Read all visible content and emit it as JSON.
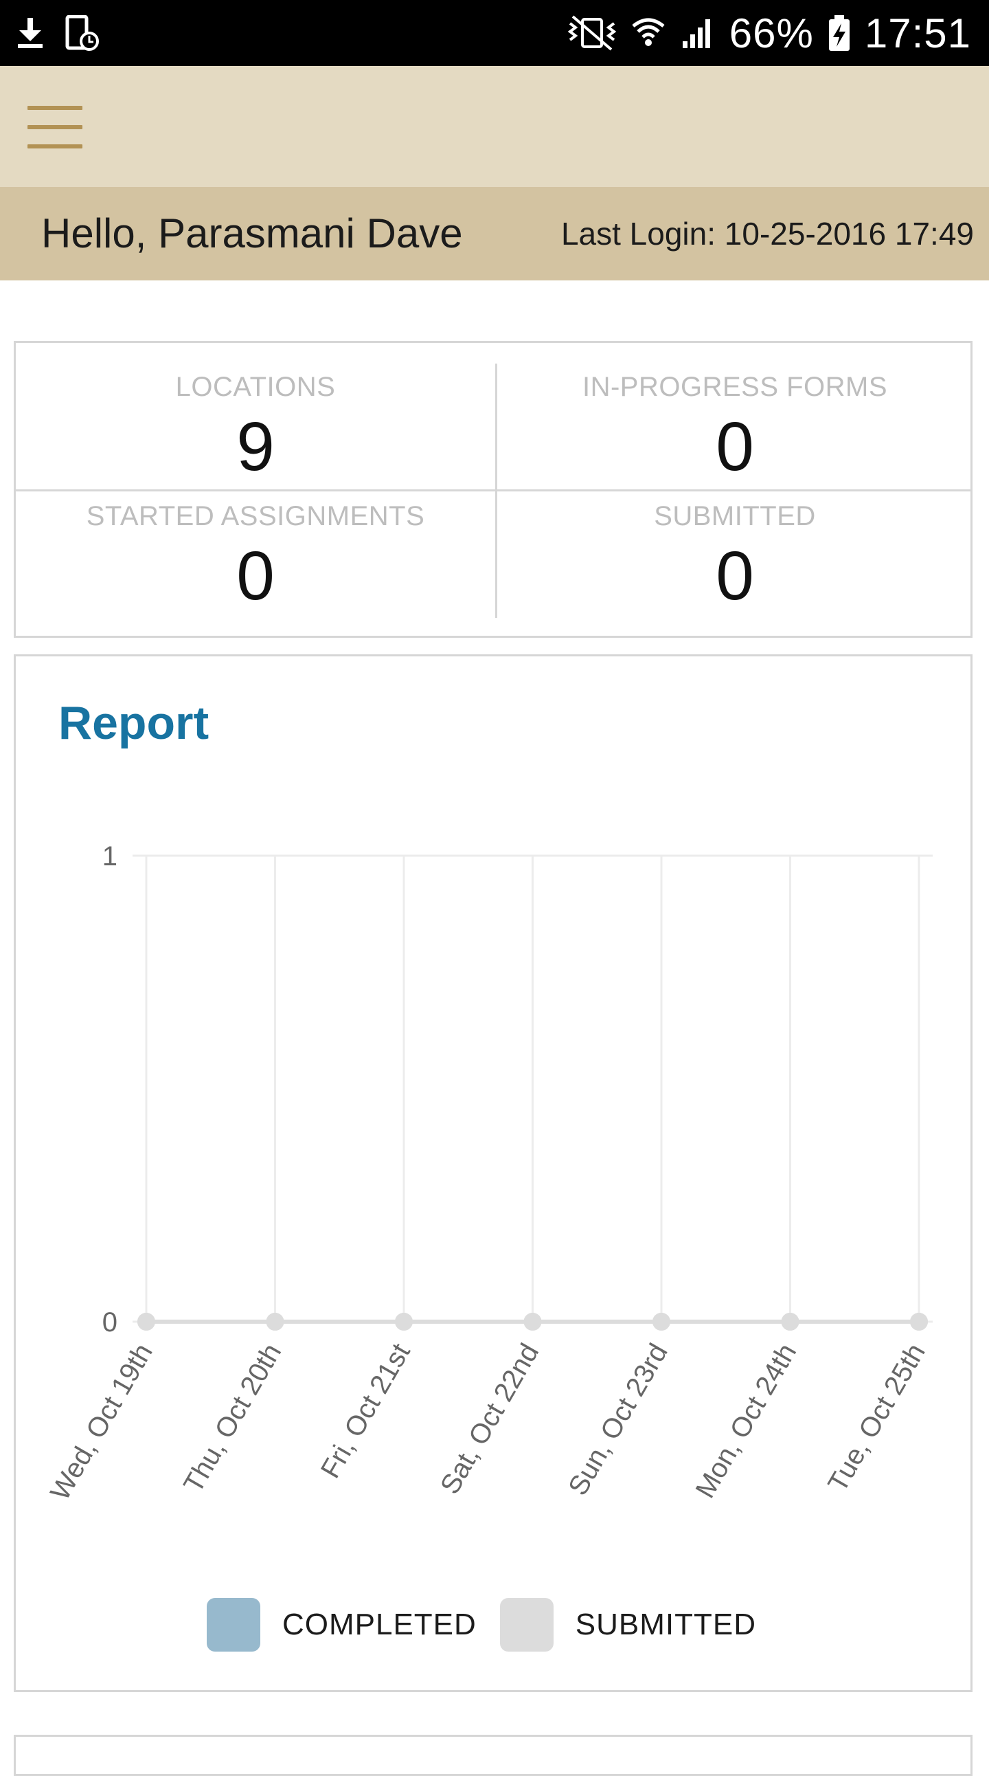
{
  "status_bar": {
    "left_icons": [
      "download-icon",
      "device-lock-icon"
    ],
    "right_icons": [
      "vibrate-icon",
      "wifi-icon",
      "signal-icon",
      "battery-charging-icon"
    ],
    "battery": "66%",
    "time": "17:51"
  },
  "app_bar": {
    "menu_icon": "hamburger-menu-icon",
    "colors": {
      "background": "#e4dac2",
      "accent": "#b29254"
    }
  },
  "greeting": {
    "text": "Hello, Parasmani Dave",
    "last_login": "Last Login: 10-25-2016 17:49",
    "background": "#d3c3a1"
  },
  "stats": [
    {
      "label": "LOCATIONS",
      "value": "9"
    },
    {
      "label": "IN-PROGRESS FORMS",
      "value": "0"
    },
    {
      "label": "STARTED ASSIGNMENTS",
      "value": "0"
    },
    {
      "label": "SUBMITTED",
      "value": "0"
    }
  ],
  "report": {
    "title": "Report",
    "title_color": "#1873a1",
    "chart_data": {
      "type": "line",
      "categories": [
        "Wed, Oct 19th",
        "Thu, Oct 20th",
        "Fri, Oct 21st",
        "Sat, Oct 22nd",
        "Sun, Oct 23rd",
        "Mon, Oct 24th",
        "Tue, Oct 25th"
      ],
      "series": [
        {
          "name": "COMPLETED",
          "values": [
            0,
            0,
            0,
            0,
            0,
            0,
            0
          ],
          "color": "#97b9cd"
        },
        {
          "name": "SUBMITTED",
          "values": [
            0,
            0,
            0,
            0,
            0,
            0,
            0
          ],
          "color": "#dcdcdc"
        }
      ],
      "y_ticks": [
        "1",
        "0"
      ],
      "ylim": [
        0,
        1
      ],
      "grid": true,
      "legend_position": "bottom"
    }
  }
}
